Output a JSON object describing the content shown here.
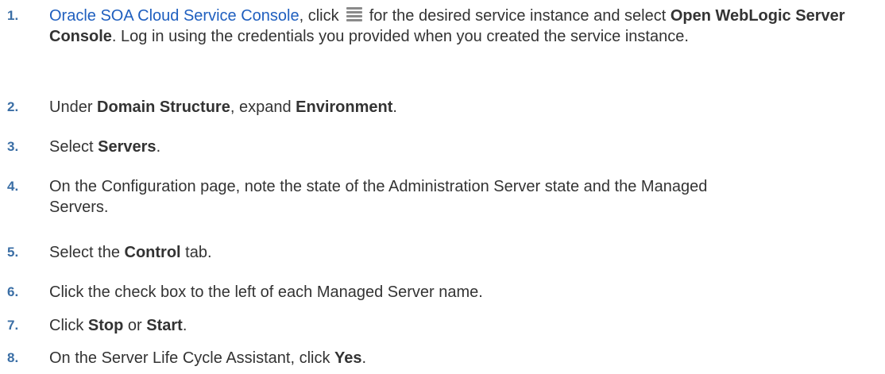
{
  "steps": [
    {
      "number": "1.",
      "link_text": "Oracle SOA Cloud Service Console",
      "t1": ", click ",
      "icon": "hamburger-menu-icon",
      "t2": " for the desired service instance and select ",
      "b1": "Open WebLogic Server Console",
      "t3": ". Log in using the credentials you provided when you created the service instance."
    },
    {
      "number": "2.",
      "t1": "Under ",
      "b1": "Domain Structure",
      "t2": ", expand ",
      "b2": "Environment",
      "t3": "."
    },
    {
      "number": "3.",
      "t1": "Select ",
      "b1": "Servers",
      "t2": "."
    },
    {
      "number": "4.",
      "t1": "On the Configuration page, note the state of the Administration Server state and the Managed Servers."
    },
    {
      "number": "5.",
      "t1": "Select the ",
      "b1": "Control",
      "t2": " tab."
    },
    {
      "number": "6.",
      "t1": "Click the check box to the left of each Managed Server name."
    },
    {
      "number": "7.",
      "t1": "Click ",
      "b1": "Stop",
      "t2": " or ",
      "b2": "Start",
      "t3": "."
    },
    {
      "number": "8.",
      "t1": "On the Server Life Cycle Assistant, click ",
      "b1": "Yes",
      "t2": "."
    }
  ],
  "colors": {
    "step_number": "#3a6ea5",
    "link": "#1f5fbf",
    "body_text": "#333333"
  }
}
